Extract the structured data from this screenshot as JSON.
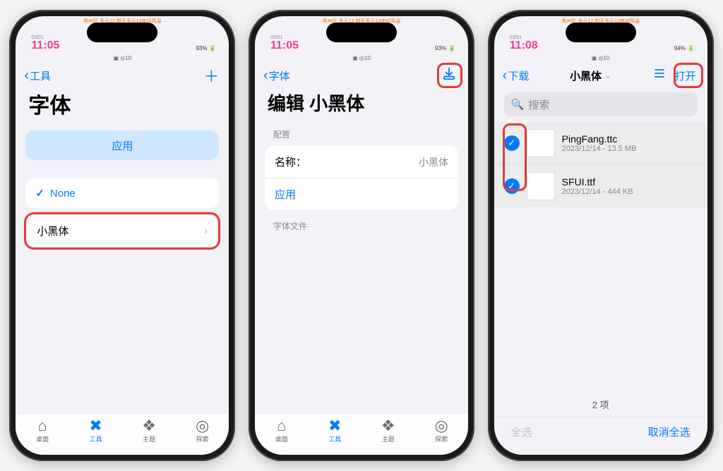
{
  "status": {
    "date": "03/01",
    "time": "11:05",
    "time3": "11:08",
    "weather": "秀州区 多云12 明天多云13夜间高温",
    "battery_pct": "93%",
    "battery_pct3": "94%",
    "sub": "▣ ◎10"
  },
  "phone1": {
    "back_label": "工具",
    "title": "字体",
    "apply_label": "应用",
    "option_none": "None",
    "option_font": "小黑体",
    "tabs": [
      "桌面",
      "工具",
      "主题",
      "探索"
    ]
  },
  "phone2": {
    "back_label": "字体",
    "title": "编辑 小黑体",
    "section_config": "配置",
    "name_label": "名称：",
    "name_value": "小黑体",
    "apply_label": "应用",
    "section_files": "字体文件",
    "tabs": [
      "桌面",
      "工具",
      "主题",
      "探索"
    ]
  },
  "phone3": {
    "back_label": "下载",
    "title": "小黑体",
    "open_label": "打开",
    "search_placeholder": "搜索",
    "files": [
      {
        "name": "PingFang.ttc",
        "meta": "2023/12/14 - 13.5 MB"
      },
      {
        "name": "SFUI.ttf",
        "meta": "2023/12/14 - 444 KB"
      }
    ],
    "count_label": "2 项",
    "select_all": "全选",
    "deselect_all": "取消全选"
  }
}
